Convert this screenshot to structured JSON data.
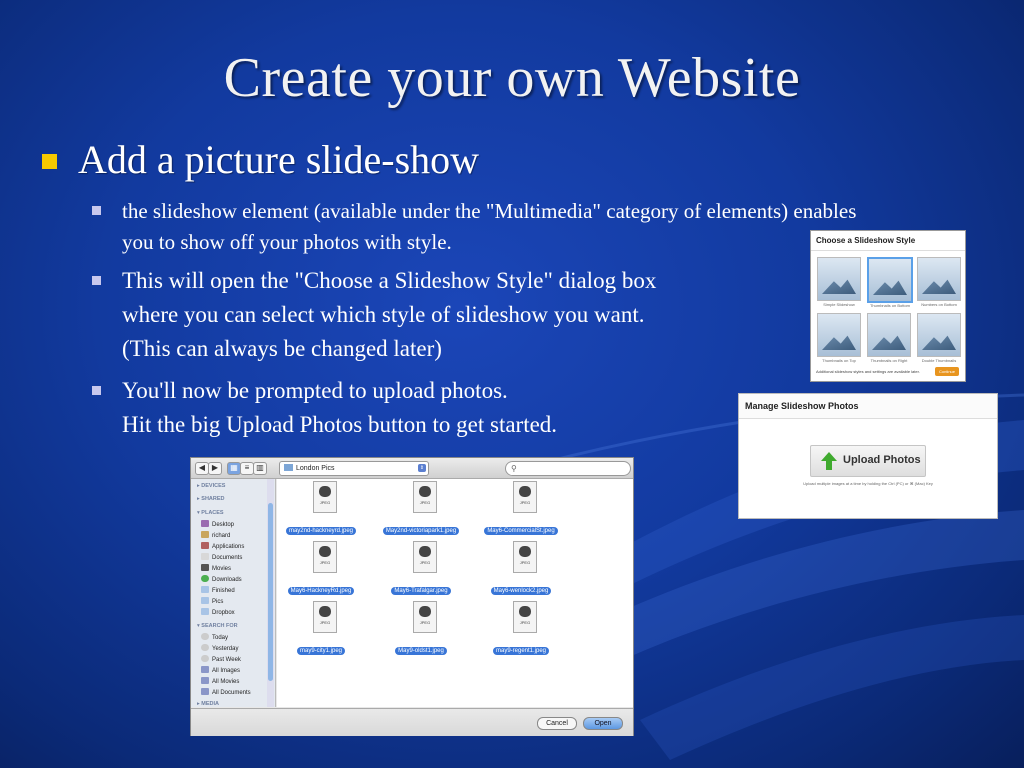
{
  "slide": {
    "title": "Create your own Website",
    "bullet": "Add a picture slide-show",
    "sub1_line1": " the slideshow element (available under the \"Multimedia\" category of elements) enables",
    "sub1_line2": "you to show off your photos with style.",
    "sub2_line1": "This will open the \"Choose a Slideshow Style\" dialog box",
    "sub2_line2": "where you can select which style of slideshow you want.",
    "sub2_line3": "(This can always be changed later)",
    "sub3_line1": "You'll now be prompted to upload photos.",
    "sub3_line2": "Hit the big Upload Photos button to get started.",
    "colors": {
      "bullet": "#f7c900",
      "sub_bullet": "#c8c8ee",
      "background": "#123a9f"
    }
  },
  "style_dialog": {
    "title": "Choose a Slideshow Style",
    "styles": [
      "Simple Slideshow",
      "Thumbnails on Bottom",
      "Numbers on Bottom",
      "Thumbnails on Top",
      "Thumbnails on Right",
      "Double Thumbnails"
    ],
    "selected": "Thumbnails on Bottom",
    "footnote": "Additional slideshow styles and settings are available later.",
    "continue_label": "Continue"
  },
  "manage_dialog": {
    "title": "Manage Slideshow Photos",
    "upload_label": "Upload Photos",
    "hint": "Upload multiple images at a time by holding the Ctrl (PC) or ⌘ (Mac) Key"
  },
  "file_dialog": {
    "location": "London Pics",
    "search_icon": "search-icon",
    "sidebar": {
      "devices": "DEVICES",
      "shared": "SHARED",
      "places": "PLACES",
      "place_items": [
        "Desktop",
        "richard",
        "Applications",
        "Documents",
        "Movies",
        "Downloads",
        "Finished",
        "Pics",
        "Dropbox"
      ],
      "search_for": "SEARCH FOR",
      "search_items": [
        "Today",
        "Yesterday",
        "Past Week",
        "All Images",
        "All Movies",
        "All Documents"
      ],
      "media": "MEDIA"
    },
    "file_type_label": "JPEG",
    "files": [
      "may2nd-hackneyrd.jpeg",
      "May2nd-victoriapark1.jpeg",
      "May6-CommercialSt.jpeg",
      "May6-HackneyRd.jpeg",
      "May6-Trafalgar.jpeg",
      "May6-wenlock2.jpeg",
      "may9-city1.jpeg",
      "May9-oldst1.jpeg",
      "may9-regent1.jpeg"
    ],
    "cancel_label": "Cancel",
    "open_label": "Open"
  }
}
